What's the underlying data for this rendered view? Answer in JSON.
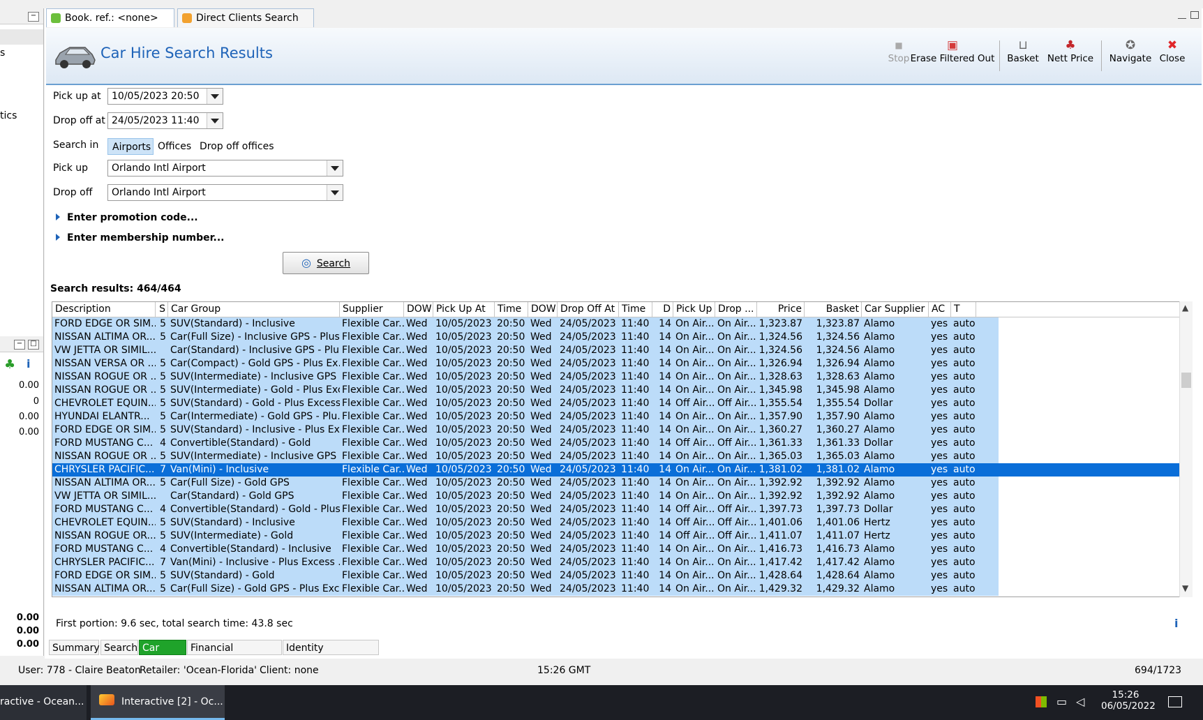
{
  "left_panel": {
    "values_top": [
      "0.00",
      "0",
      "0.00",
      "0.00"
    ],
    "values_bottom": [
      "0.00",
      "0.00",
      "0.00"
    ],
    "partial_labels": [
      "s",
      "tics"
    ]
  },
  "tabs": [
    {
      "label": "Book. ref.: <none>",
      "close": "✕"
    },
    {
      "label": "Direct Clients Search"
    }
  ],
  "header": {
    "title": "Car Hire Search Results"
  },
  "toolbar": {
    "stop": "Stop",
    "erase": "Erase Filtered Out",
    "basket": "Basket",
    "nett_price": "Nett Price",
    "navigate": "Navigate",
    "close": "Close"
  },
  "form": {
    "pickup_at_label": "Pick up at",
    "pickup_at_value": "10/05/2023 20:50",
    "dropoff_at_label": "Drop off at",
    "dropoff_at_value": "24/05/2023 11:40",
    "search_in_label": "Search in",
    "search_in_options": [
      "Airports",
      "Offices",
      "Drop off offices"
    ],
    "pickup_label": "Pick up",
    "pickup_value": "Orlando Intl Airport",
    "dropoff_label": "Drop off",
    "dropoff_value": "Orlando Intl Airport",
    "promo": "Enter promotion code...",
    "membership": "Enter membership number...",
    "search_button": "Search"
  },
  "results": {
    "count_label": "Search results: 464/464",
    "columns": [
      "Description",
      "S",
      "Car Group",
      "Supplier",
      "DOW",
      "Pick Up At",
      "Time",
      "DOW",
      "Drop Off At",
      "Time",
      "D",
      "Pick Up",
      "Drop ...",
      "Price",
      "Basket",
      "Car Supplier",
      "AC",
      "T"
    ],
    "rows": [
      [
        "FORD EDGE OR SIM...",
        "5",
        "SUV(Standard) - Inclusive",
        "Flexible Car...",
        "Wed",
        "10/05/2023",
        "20:50",
        "Wed",
        "24/05/2023",
        "11:40",
        "14",
        "On Air...",
        "On Air...",
        "1,323.87",
        "1,323.87",
        "Alamo",
        "yes",
        "auto"
      ],
      [
        "NISSAN ALTIMA OR...",
        "5",
        "Car(Full Size) - Inclusive GPS - Plus ...",
        "Flexible Car...",
        "Wed",
        "10/05/2023",
        "20:50",
        "Wed",
        "24/05/2023",
        "11:40",
        "14",
        "On Air...",
        "On Air...",
        "1,324.56",
        "1,324.56",
        "Alamo",
        "yes",
        "auto"
      ],
      [
        "VW JETTA OR SIMIL...",
        "",
        "Car(Standard) - Inclusive GPS - Plu...",
        "Flexible Car...",
        "Wed",
        "10/05/2023",
        "20:50",
        "Wed",
        "24/05/2023",
        "11:40",
        "14",
        "On Air...",
        "On Air...",
        "1,324.56",
        "1,324.56",
        "Alamo",
        "yes",
        "auto"
      ],
      [
        "NISSAN VERSA OR ...",
        "5",
        "Car(Compact) - Gold GPS - Plus Ex...",
        "Flexible Car...",
        "Wed",
        "10/05/2023",
        "20:50",
        "Wed",
        "24/05/2023",
        "11:40",
        "14",
        "On Air...",
        "On Air...",
        "1,326.94",
        "1,326.94",
        "Alamo",
        "yes",
        "auto"
      ],
      [
        "NISSAN ROGUE OR ...",
        "5",
        "SUV(Intermediate) - Inclusive GPS",
        "Flexible Car...",
        "Wed",
        "10/05/2023",
        "20:50",
        "Wed",
        "24/05/2023",
        "11:40",
        "14",
        "On Air...",
        "On Air...",
        "1,328.63",
        "1,328.63",
        "Alamo",
        "yes",
        "auto"
      ],
      [
        "NISSAN ROGUE OR ...",
        "5",
        "SUV(Intermediate) - Gold - Plus Exc...",
        "Flexible Car...",
        "Wed",
        "10/05/2023",
        "20:50",
        "Wed",
        "24/05/2023",
        "11:40",
        "14",
        "On Air...",
        "On Air...",
        "1,345.98",
        "1,345.98",
        "Alamo",
        "yes",
        "auto"
      ],
      [
        "CHEVROLET EQUIN...",
        "5",
        "SUV(Standard) - Gold - Plus Excess ...",
        "Flexible Car...",
        "Wed",
        "10/05/2023",
        "20:50",
        "Wed",
        "24/05/2023",
        "11:40",
        "14",
        "Off Air...",
        "Off Air...",
        "1,355.54",
        "1,355.54",
        "Dollar",
        "yes",
        "auto"
      ],
      [
        "HYUNDAI ELANTR...",
        "5",
        "Car(Intermediate) - Gold GPS - Plu...",
        "Flexible Car...",
        "Wed",
        "10/05/2023",
        "20:50",
        "Wed",
        "24/05/2023",
        "11:40",
        "14",
        "On Air...",
        "On Air...",
        "1,357.90",
        "1,357.90",
        "Alamo",
        "yes",
        "auto"
      ],
      [
        "FORD EDGE OR SIM...",
        "5",
        "SUV(Standard) - Inclusive - Plus Ex...",
        "Flexible Car...",
        "Wed",
        "10/05/2023",
        "20:50",
        "Wed",
        "24/05/2023",
        "11:40",
        "14",
        "On Air...",
        "On Air...",
        "1,360.27",
        "1,360.27",
        "Alamo",
        "yes",
        "auto"
      ],
      [
        "FORD MUSTANG C...",
        "4",
        "Convertible(Standard) - Gold",
        "Flexible Car...",
        "Wed",
        "10/05/2023",
        "20:50",
        "Wed",
        "24/05/2023",
        "11:40",
        "14",
        "Off Air...",
        "Off Air...",
        "1,361.33",
        "1,361.33",
        "Dollar",
        "yes",
        "auto"
      ],
      [
        "NISSAN ROGUE OR ...",
        "5",
        "SUV(Intermediate) - Inclusive GPS -...",
        "Flexible Car...",
        "Wed",
        "10/05/2023",
        "20:50",
        "Wed",
        "24/05/2023",
        "11:40",
        "14",
        "On Air...",
        "On Air...",
        "1,365.03",
        "1,365.03",
        "Alamo",
        "yes",
        "auto"
      ],
      [
        "CHRYSLER PACIFIC...",
        "7",
        "Van(Mini) - Inclusive",
        "Flexible Car...",
        "Wed",
        "10/05/2023",
        "20:50",
        "Wed",
        "24/05/2023",
        "11:40",
        "14",
        "On Air...",
        "On Air...",
        "1,381.02",
        "1,381.02",
        "Alamo",
        "yes",
        "auto"
      ],
      [
        "NISSAN ALTIMA OR...",
        "5",
        "Car(Full Size) - Gold GPS",
        "Flexible Car...",
        "Wed",
        "10/05/2023",
        "20:50",
        "Wed",
        "24/05/2023",
        "11:40",
        "14",
        "On Air...",
        "On Air...",
        "1,392.92",
        "1,392.92",
        "Alamo",
        "yes",
        "auto"
      ],
      [
        "VW JETTA OR SIMIL...",
        "",
        "Car(Standard) - Gold GPS",
        "Flexible Car...",
        "Wed",
        "10/05/2023",
        "20:50",
        "Wed",
        "24/05/2023",
        "11:40",
        "14",
        "On Air...",
        "On Air...",
        "1,392.92",
        "1,392.92",
        "Alamo",
        "yes",
        "auto"
      ],
      [
        "FORD MUSTANG C...",
        "4",
        "Convertible(Standard) - Gold - Plus...",
        "Flexible Car...",
        "Wed",
        "10/05/2023",
        "20:50",
        "Wed",
        "24/05/2023",
        "11:40",
        "14",
        "Off Air...",
        "Off Air...",
        "1,397.73",
        "1,397.73",
        "Dollar",
        "yes",
        "auto"
      ],
      [
        "CHEVROLET EQUIN...",
        "5",
        "SUV(Standard) - Inclusive",
        "Flexible Car...",
        "Wed",
        "10/05/2023",
        "20:50",
        "Wed",
        "24/05/2023",
        "11:40",
        "14",
        "Off Air...",
        "Off Air...",
        "1,401.06",
        "1,401.06",
        "Hertz",
        "yes",
        "auto"
      ],
      [
        " NISSAN ROGUE OR...",
        "5",
        "SUV(Intermediate) - Gold",
        "Flexible Car...",
        "Wed",
        "10/05/2023",
        "20:50",
        "Wed",
        "24/05/2023",
        "11:40",
        "14",
        "Off Air...",
        "Off Air...",
        "1,411.07",
        "1,411.07",
        "Hertz",
        "yes",
        "auto"
      ],
      [
        "FORD MUSTANG C...",
        "4",
        "Convertible(Standard) - Inclusive",
        "Flexible Car...",
        "Wed",
        "10/05/2023",
        "20:50",
        "Wed",
        "24/05/2023",
        "11:40",
        "14",
        "On Air...",
        "On Air...",
        "1,416.73",
        "1,416.73",
        "Alamo",
        "yes",
        "auto"
      ],
      [
        "CHRYSLER PACIFIC...",
        "7",
        "Van(Mini) - Inclusive - Plus Excess ...",
        "Flexible Car...",
        "Wed",
        "10/05/2023",
        "20:50",
        "Wed",
        "24/05/2023",
        "11:40",
        "14",
        "On Air...",
        "On Air...",
        "1,417.42",
        "1,417.42",
        "Alamo",
        "yes",
        "auto"
      ],
      [
        "FORD EDGE OR SIM...",
        "5",
        "SUV(Standard) - Gold",
        "Flexible Car...",
        "Wed",
        "10/05/2023",
        "20:50",
        "Wed",
        "24/05/2023",
        "11:40",
        "14",
        "On Air...",
        "On Air...",
        "1,428.64",
        "1,428.64",
        "Alamo",
        "yes",
        "auto"
      ],
      [
        "NISSAN ALTIMA OR...",
        "5",
        "Car(Full Size) - Gold GPS - Plus Exc...",
        "Flexible Car...",
        "Wed",
        "10/05/2023",
        "20:50",
        "Wed",
        "24/05/2023",
        "11:40",
        "14",
        "On Air...",
        "On Air...",
        "1,429.32",
        "1,429.32",
        "Alamo",
        "yes",
        "auto"
      ]
    ],
    "selected_row": 11
  },
  "footer": {
    "message": "First portion: 9.6 sec, total search time: 43.8 sec",
    "tabs": [
      "Summary",
      "Search",
      "Car MCO",
      "Financial Summary",
      "Identity Documents"
    ],
    "active_tab": "Car MCO"
  },
  "statusbar": {
    "user": "User: 778 - Claire Beaton",
    "retailer": "Retailer: 'Ocean-Florida'",
    "client": "Client: none",
    "time": "15:26 GMT",
    "position": "694/1723"
  },
  "taskbar": {
    "items": [
      "ractive - Ocean...",
      "Interactive [2] - Oc..."
    ],
    "clock_time": "15:26",
    "clock_date": "06/05/2022"
  },
  "colors": {
    "accent": "#1e63b8",
    "row_bg": "#bcdcf9",
    "row_selected": "#0a6ed8",
    "active_tab": "#1fa32a"
  }
}
